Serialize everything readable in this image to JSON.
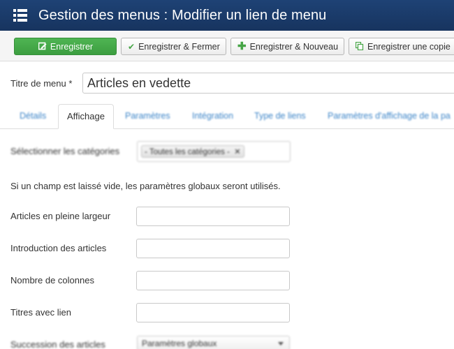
{
  "header": {
    "title": "Gestion des menus : Modifier un lien de menu",
    "icon": "menu-list-icon"
  },
  "toolbar": {
    "save_label": "Enregistrer",
    "save_close_label": "Enregistrer & Fermer",
    "save_new_label": "Enregistrer & Nouveau",
    "save_copy_label": "Enregistrer une copie",
    "accent": "#46a546"
  },
  "form": {
    "title_label": "Titre de menu *",
    "title_value": "Articles en vedette"
  },
  "tabs": [
    {
      "label": "Détails"
    },
    {
      "label": "Affichage"
    },
    {
      "label": "Paramètres"
    },
    {
      "label": "Intégration"
    },
    {
      "label": "Type de liens"
    },
    {
      "label": "Paramètres d'affichage de la pa"
    }
  ],
  "content": {
    "categories_label": "Sélectionner les catégories",
    "categories_chip": "- Toutes les catégories -",
    "info": "Si un champ est laissé vide, les paramètres globaux seront utilisés.",
    "fields": [
      {
        "label": "Articles en pleine largeur",
        "value": ""
      },
      {
        "label": "Introduction des articles",
        "value": ""
      },
      {
        "label": "Nombre de colonnes",
        "value": ""
      },
      {
        "label": "Titres avec lien",
        "value": ""
      }
    ],
    "succession_label": "Succession des articles",
    "succession_value": "Paramètres globaux"
  }
}
